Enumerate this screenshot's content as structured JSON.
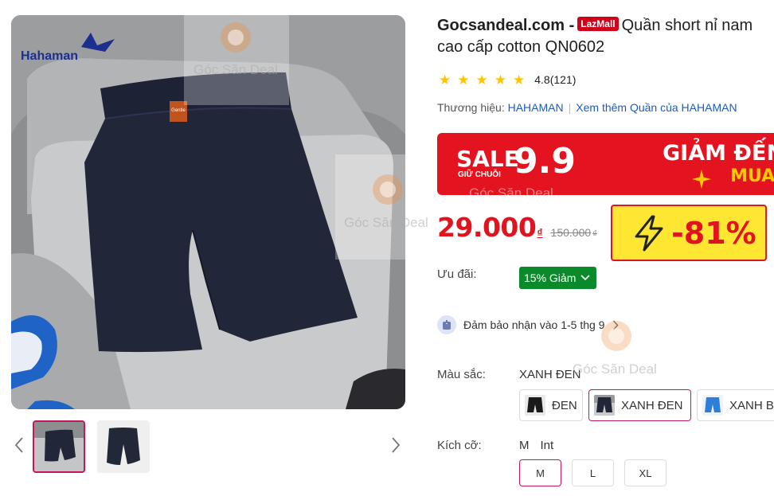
{
  "product": {
    "shop": "Gocsandeal.com -",
    "badge": "LazMall",
    "title_line1": "Quần short nỉ nam",
    "title_line2": "cao cấp cotton QN0602",
    "rating": "4.8(121)",
    "stars": 5
  },
  "brand": {
    "label": "Thương hiệu:",
    "name": "HAHAMAN",
    "more": "Xem thêm Quần của HAHAMAN"
  },
  "banner": {
    "sale": "SALE",
    "sale_sub": "GIỮ CHUỖI",
    "date": "9.9",
    "giam": "GIẢM ĐẾN",
    "mua": "MUA"
  },
  "price": {
    "current": "29.000",
    "currency": "₫",
    "old": "150.000",
    "old_currency": "₫",
    "discount": "-81%"
  },
  "offer": {
    "label": "Ưu đãi:",
    "voucher": "15% Giảm"
  },
  "delivery": {
    "text": "Đảm bảo nhận vào 1-5 thg 9"
  },
  "color": {
    "label": "Màu sắc:",
    "selected": "XANH ĐEN",
    "options": [
      "ĐEN",
      "XANH ĐEN",
      "XANH B"
    ]
  },
  "size": {
    "label": "Kích cỡ:",
    "selected": "M",
    "unit": "Int",
    "options": [
      "M",
      "L",
      "XL"
    ]
  },
  "image": {
    "brand_logo": "Hahaman",
    "tag": "Gentle"
  },
  "watermark": "Góc Săn Deal",
  "colors": {
    "price_red": "#e0141f",
    "accent_pink": "#c2185b",
    "link_blue": "#1a5cc6",
    "voucher_green": "#0a8a2a",
    "star_yellow": "#ffc400",
    "discount_yellow": "#ffe633"
  }
}
